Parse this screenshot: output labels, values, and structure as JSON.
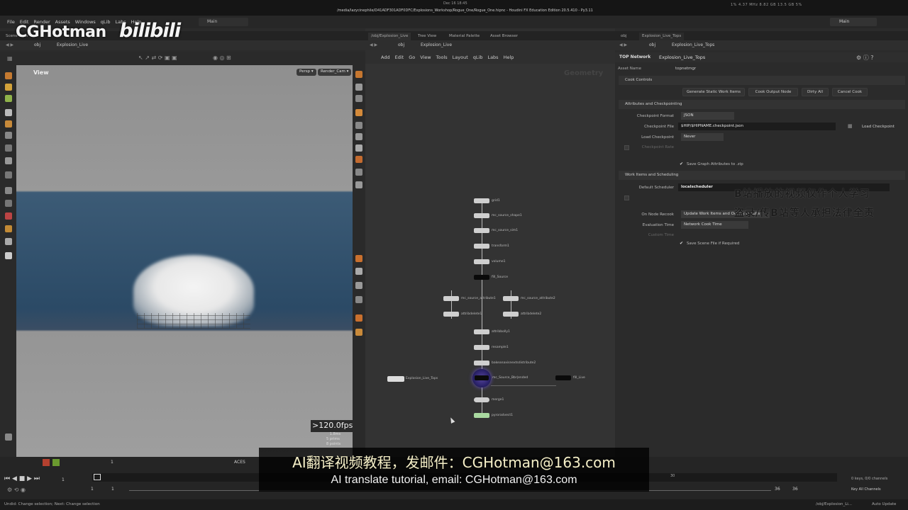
{
  "system_bar": {
    "date": "Dec 16  18:45",
    "title": "/media/lazycinephile/D41ADF301ADF0DFC/Explosions_Workshop/Rogue_One/Rogue_One.hipnc - Houdini FX Education Edition 20.5.410 - Py3.11",
    "stats": "1% 4.37 MHz   8.82 GB 13.5 GB   5%"
  },
  "menubar": {
    "items": [
      "File",
      "Edit",
      "Render",
      "Assets",
      "Windows",
      "qLib",
      "Labs",
      "Help"
    ],
    "desktop_left": "Main",
    "desktop_right": "Main"
  },
  "watermark": {
    "brand": "CGHotman",
    "platform": "bilibili"
  },
  "left_panel": {
    "tab": "Scene View",
    "path": "obj",
    "node": "Explosion_Live",
    "view_label": "View",
    "persp": "Persp ▾",
    "camera": "Render_Cam ▾",
    "fps": ">120.0fps",
    "stats_lines": [
      "1.8ms",
      "5  prims",
      "8  points"
    ]
  },
  "network_panel": {
    "tabs": [
      "/obj/Explosion_Live",
      "Tree View",
      "Material Palette",
      "Asset Browser"
    ],
    "path": "obj",
    "node": "Explosion_Live",
    "menu": [
      "Add",
      "Edit",
      "Go",
      "View",
      "Tools",
      "Layout",
      "qLib",
      "Labs",
      "Help"
    ],
    "context_label": "Geometry",
    "nodes": [
      "grid1",
      "mc_source_shape1",
      "mc_source_sim1",
      "transform1",
      "volume1",
      "fill_Source",
      "mc_source_attribute1",
      "mc_source_attribute2",
      "attribdelete1",
      "attribdelete2",
      "attribbolly1",
      "resample1",
      "bakeanaxisnextsdistribute2",
      "mc_Source_Bbr|ended",
      "merge1",
      "pyroradvect1",
      "fill_Live",
      "Explosion_Live_Tops"
    ]
  },
  "parm_panel": {
    "tabs": [
      "obj",
      "Explosion_Live_Tops"
    ],
    "path": "obj",
    "node": "Explosion_Live_Tops",
    "type_label": "TOP Network",
    "type_value": "Explosion_Live_Tops",
    "asset_name_label": "Asset Name",
    "asset_name_value": "topnetmgr",
    "cook_controls": "Cook Controls",
    "buttons": [
      "Generate Static Work Items",
      "Cook Output Node",
      "Dirty All",
      "Cancel Cook"
    ],
    "attrs_section": "Attributes and Checkpointing",
    "checkpoint_format_label": "Checkpoint Format",
    "checkpoint_format_value": "JSON",
    "checkpoint_file_label": "Checkpoint File",
    "checkpoint_file_value": "$HIP/$HIPNAME.checkpoint.json",
    "load_checkpoint_btn": "Load Checkpoint",
    "load_checkpoint_label": "Load Checkpoint",
    "load_checkpoint_value": "Never",
    "checkpoint_rate_label": "Checkpoint Rate",
    "save_graph_attrs": "Save Graph Attributes to .zip",
    "work_section": "Work Items and Scheduling",
    "default_scheduler_label": "Default Scheduler",
    "default_scheduler_value": "localscheduler",
    "on_node_recook_label": "On Node Recook",
    "on_node_recook_value": "Update Work Items and Output Results",
    "eval_time_label": "Evaluation Time",
    "eval_time_value": "Network Cook Time",
    "custom_time_label": "Custom Time",
    "save_scene": "Save Scene File if Required",
    "overlay_line1": "B站播放的视频仅作个人学习",
    "overlay_line2": "盗录/传B站等人承担法律全责"
  },
  "timeline": {
    "frame_start": "1",
    "frame_current": "1",
    "frame_end": "36",
    "frame_end2": "36",
    "keys": "0 keys, 0/0 channels",
    "key_all": "Key All Channels",
    "ticks": [
      "1",
      "12",
      "24",
      "30",
      "36"
    ],
    "aces": "ACES"
  },
  "status": {
    "left": "Undid: Change selection; Next: Change selection",
    "right_path": "/obj/Explosion_Li...",
    "auto_update": "Auto Update"
  },
  "subtitle": {
    "cn": "AI翻译视频教程，发邮件：CGHotman@163.com",
    "en": "AI translate tutorial, email: CGHotman@163.com"
  }
}
